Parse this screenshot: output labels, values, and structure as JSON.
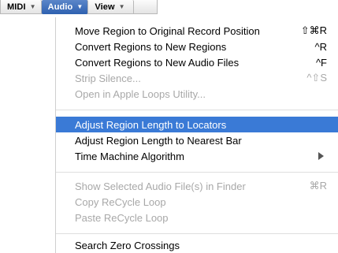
{
  "menubar": {
    "items": [
      {
        "label": "MIDI"
      },
      {
        "label": "Audio"
      },
      {
        "label": "View"
      }
    ]
  },
  "menu": {
    "items": [
      {
        "label": "Move Region to Original Record Position",
        "shortcut": "⇧⌘R"
      },
      {
        "label": "Convert Regions to New Regions",
        "shortcut": "^R"
      },
      {
        "label": "Convert Regions to New Audio Files",
        "shortcut": "^F"
      },
      {
        "label": "Strip Silence...",
        "shortcut": "^⇧S"
      },
      {
        "label": "Open in Apple Loops Utility..."
      },
      {
        "label": "Adjust Region Length to Locators"
      },
      {
        "label": "Adjust Region Length to Nearest Bar"
      },
      {
        "label": "Time Machine Algorithm",
        "submenu_icon": "submenu-arrow-icon"
      },
      {
        "label": "Show Selected Audio File(s) in Finder",
        "shortcut": "⌘R"
      },
      {
        "label": "Copy ReCycle Loop"
      },
      {
        "label": "Paste ReCycle Loop"
      },
      {
        "label": "Search Zero Crossings"
      }
    ]
  },
  "colors": {
    "highlight": "#3a7ad6",
    "disabled_text": "#a8a8a8"
  }
}
